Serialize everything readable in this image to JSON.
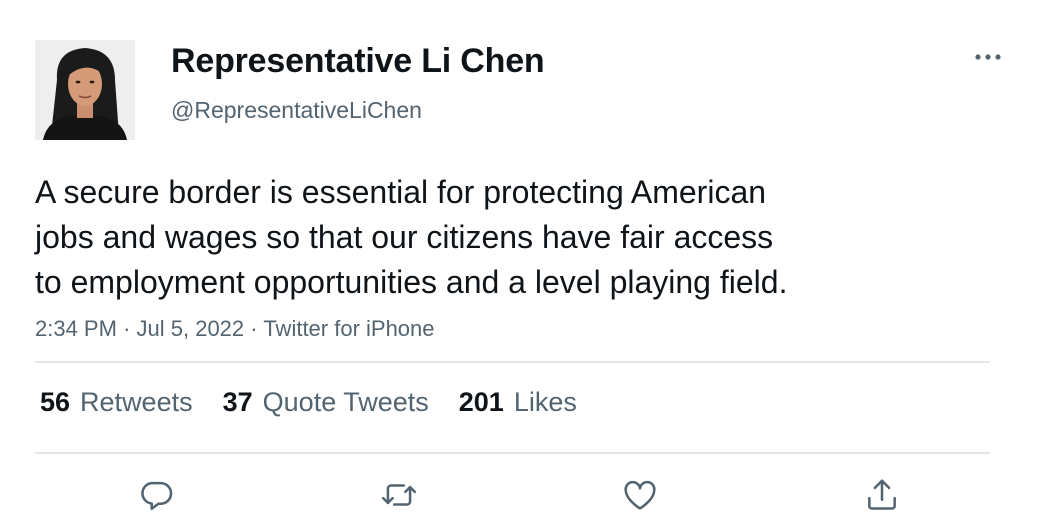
{
  "author": {
    "display_name": "Representative Li Chen",
    "handle": "@RepresentativeLiChen"
  },
  "tweet": {
    "text_lines": [
      "A secure border is essential for protecting American",
      "jobs and wages so that our citizens have fair access",
      "to employment opportunities and a level playing field."
    ],
    "time": "2:34 PM",
    "separator": "·",
    "date": "Jul 5, 2022",
    "source": "Twitter for iPhone"
  },
  "stats": {
    "retweets_count": "56",
    "retweets_label": "Retweets",
    "quote_tweets_count": "37",
    "quote_tweets_label": "Quote Tweets",
    "likes_count": "201",
    "likes_label": "Likes"
  },
  "icons": {
    "more": "more-horizontal-icon",
    "reply": "reply-icon",
    "retweet": "retweet-icon",
    "like": "heart-icon",
    "share": "share-icon"
  },
  "colors": {
    "text": "#0f1419",
    "secondary_text": "#536471",
    "divider": "#e1e6ea",
    "icon": "#536471"
  }
}
